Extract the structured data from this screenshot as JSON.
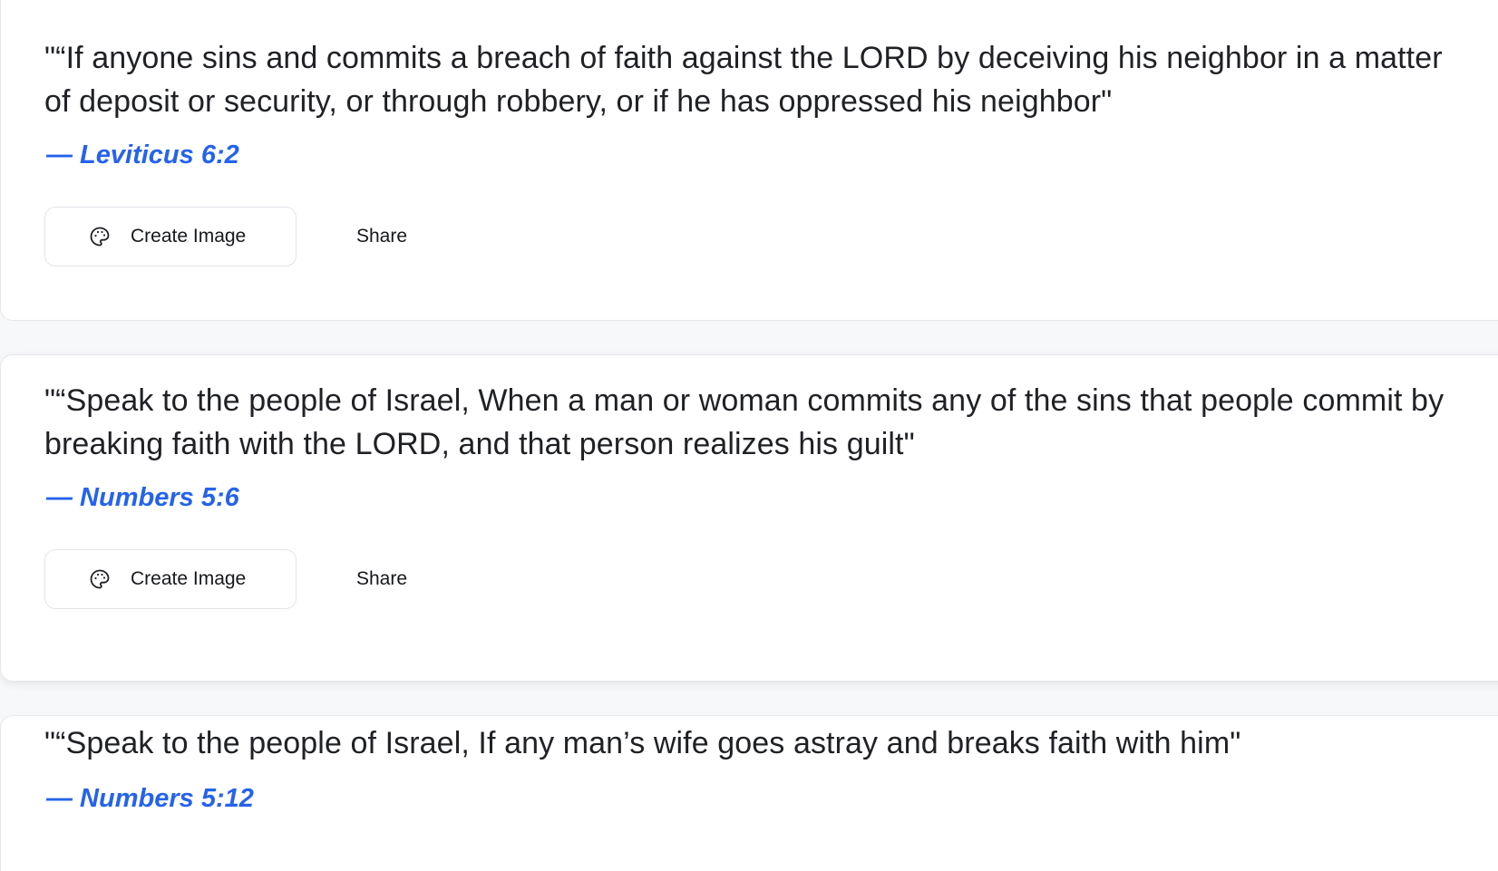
{
  "verses": [
    {
      "quote": "\"“If anyone sins and commits a breach of faith against the LORD by deceiving his neighbor in a matter of deposit or security, or through robbery, or if he has oppressed his neighbor\"",
      "reference": "— Leviticus 6:2",
      "create_image_label": "Create Image",
      "share_label": "Share"
    },
    {
      "quote": "\"“Speak to the people of Israel, When a man or woman commits any of the sins that people commit by breaking faith with the LORD, and that person realizes his guilt\"",
      "reference": "— Numbers 5:6",
      "create_image_label": "Create Image",
      "share_label": "Share"
    },
    {
      "quote": "\"“Speak to the people of Israel, If any man’s wife goes astray and breaks faith with him\"",
      "reference": "— Numbers 5:12"
    }
  ],
  "icons": {
    "create_image": "palette-icon"
  },
  "colors": {
    "reference": "#2563eb",
    "text": "#1f2125",
    "card_border": "#e5e7eb"
  }
}
